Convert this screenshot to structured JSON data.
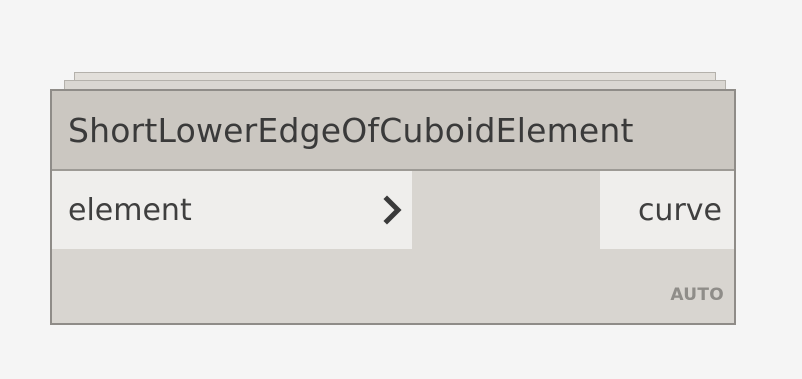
{
  "node": {
    "title": "ShortLowerEdgeOfCuboidElement",
    "inputs": [
      {
        "label": "element"
      }
    ],
    "outputs": [
      {
        "label": "curve"
      }
    ],
    "lacing": "AUTO"
  },
  "icons": {
    "input_port_indicator": "chevron-right-icon"
  },
  "colors": {
    "canvas_background": "#f5f5f5",
    "node_body": "#d8d5d0",
    "node_header": "#cbc7c1",
    "node_border": "#8f8c88",
    "port_background": "#efeeec",
    "text": "#3a3a3a",
    "lacing_text": "#8f8d89"
  }
}
